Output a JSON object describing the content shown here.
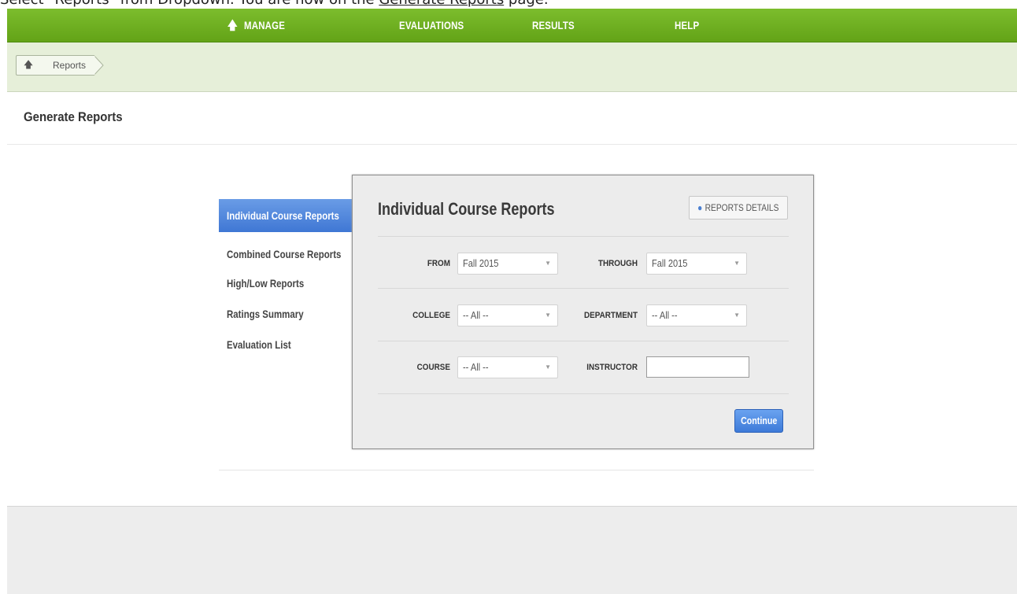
{
  "caption": {
    "text_before": "Select \"Reports\" from Dropdown. You are now on the ",
    "link_text": "Generate Reports",
    "text_after": " page."
  },
  "topnav": {
    "items": [
      {
        "label": "MANAGE",
        "icon": "home-icon"
      },
      {
        "label": "EVALUATIONS"
      },
      {
        "label": "RESULTS"
      },
      {
        "label": "HELP"
      }
    ]
  },
  "breadcrumb": {
    "home_icon": "home-icon",
    "current": "Reports"
  },
  "page": {
    "title": "Generate Reports"
  },
  "sidebar": {
    "active": "Individual Course Reports",
    "items": [
      "Combined Course Reports",
      "High/Low Reports",
      "Ratings Summary",
      "Evaluation List"
    ]
  },
  "panel": {
    "title": "Individual Course Reports",
    "details_button": "REPORTS DETAILS",
    "details_icon": "search-icon",
    "fields": {
      "from": {
        "label": "FROM",
        "value": "Fall 2015"
      },
      "through": {
        "label": "THROUGH",
        "value": "Fall 2015"
      },
      "college": {
        "label": "COLLEGE",
        "value": "-- All --"
      },
      "department": {
        "label": "DEPARTMENT",
        "value": "-- All --"
      },
      "course": {
        "label": "COURSE",
        "value": "-- All --"
      },
      "instructor": {
        "label": "INSTRUCTOR",
        "value": ""
      }
    },
    "continue_button": "Continue"
  },
  "colors": {
    "nav_green": "#6aab1f",
    "crumb_bg": "#e6efd9",
    "accent_blue": "#4a82db"
  }
}
